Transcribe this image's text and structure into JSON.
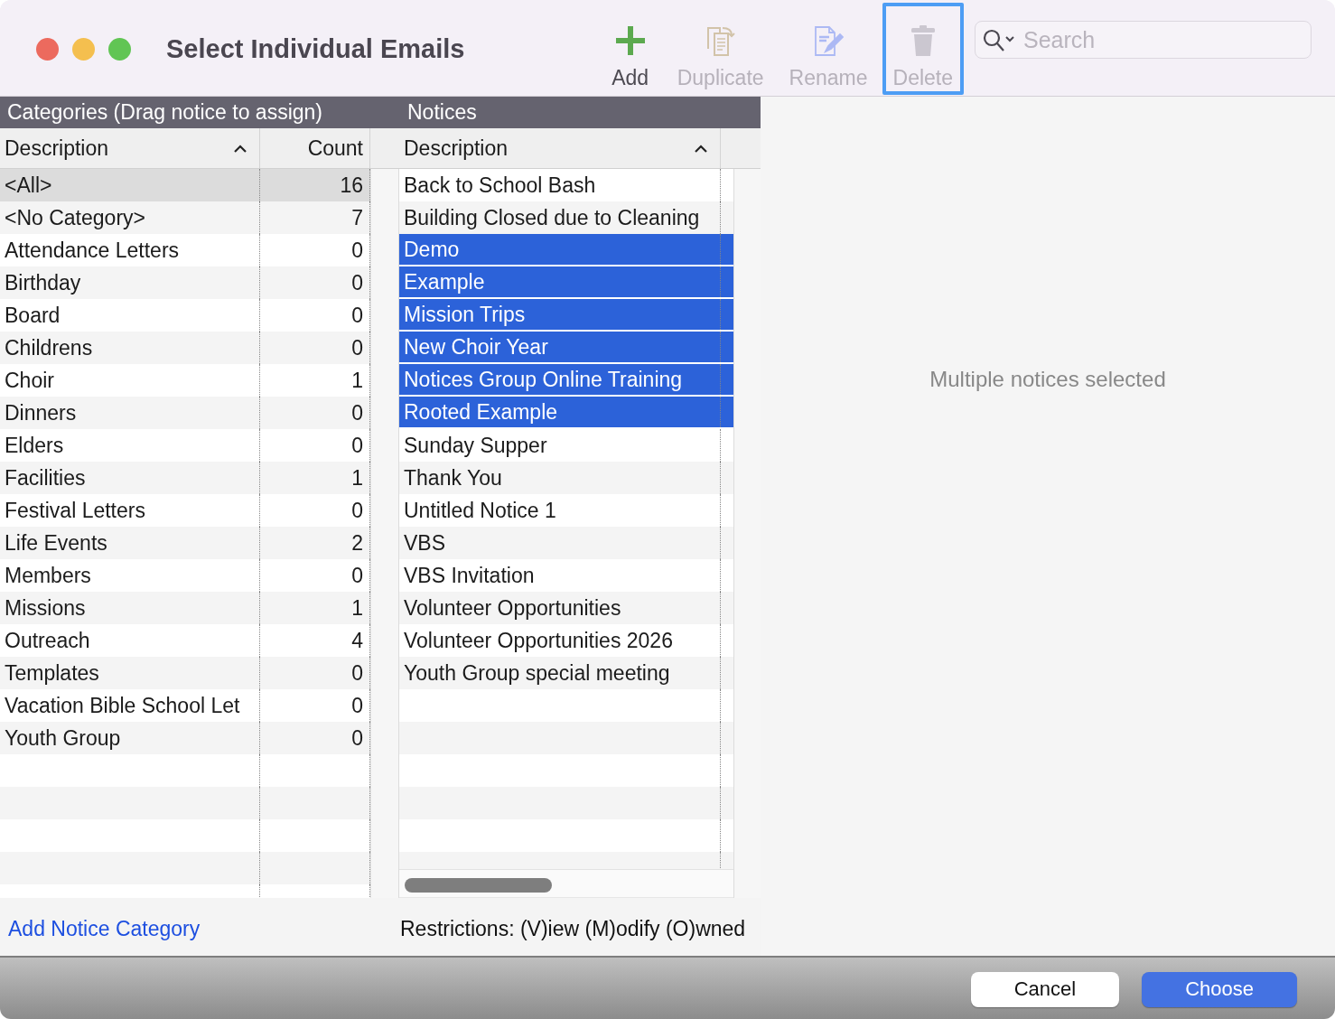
{
  "window": {
    "title": "Select Individual Emails"
  },
  "toolbar": [
    {
      "kind": "add",
      "label": "Add",
      "disabled": false,
      "focused": false
    },
    {
      "kind": "duplicate",
      "label": "Duplicate",
      "disabled": true,
      "focused": false
    },
    {
      "kind": "rename",
      "label": "Rename",
      "disabled": true,
      "focused": false
    },
    {
      "kind": "delete",
      "label": "Delete",
      "disabled": true,
      "focused": true
    }
  ],
  "search": {
    "placeholder": "Search"
  },
  "categories": {
    "title": "Categories (Drag notice to assign)",
    "columns": [
      {
        "label": "Description",
        "sorted": true
      },
      {
        "label": "Count",
        "sorted": false
      }
    ],
    "rows": [
      {
        "description": "<All>",
        "count": "16",
        "selected": true
      },
      {
        "description": "<No Category>",
        "count": "7",
        "selected": false
      },
      {
        "description": "Attendance Letters",
        "count": "0",
        "selected": false
      },
      {
        "description": "Birthday",
        "count": "0",
        "selected": false
      },
      {
        "description": "Board",
        "count": "0",
        "selected": false
      },
      {
        "description": "Childrens",
        "count": "0",
        "selected": false
      },
      {
        "description": "Choir",
        "count": "1",
        "selected": false
      },
      {
        "description": "Dinners",
        "count": "0",
        "selected": false
      },
      {
        "description": "Elders",
        "count": "0",
        "selected": false
      },
      {
        "description": "Facilities",
        "count": "1",
        "selected": false
      },
      {
        "description": "Festival Letters",
        "count": "0",
        "selected": false
      },
      {
        "description": "Life Events",
        "count": "2",
        "selected": false
      },
      {
        "description": "Members",
        "count": "0",
        "selected": false
      },
      {
        "description": "Missions",
        "count": "1",
        "selected": false
      },
      {
        "description": "Outreach",
        "count": "4",
        "selected": false
      },
      {
        "description": "Templates",
        "count": "0",
        "selected": false
      },
      {
        "description": "Vacation Bible School Let",
        "count": "0",
        "selected": false
      },
      {
        "description": "Youth Group",
        "count": "0",
        "selected": false
      }
    ]
  },
  "notices": {
    "title": "Notices",
    "columns": [
      {
        "label": "Description",
        "sorted": true
      }
    ],
    "rows": [
      {
        "description": "Back to School Bash",
        "selected": false
      },
      {
        "description": "Building Closed due to Cleaning",
        "selected": false
      },
      {
        "description": "Demo",
        "selected": true
      },
      {
        "description": "Example",
        "selected": true
      },
      {
        "description": "Mission Trips",
        "selected": true
      },
      {
        "description": "New Choir Year",
        "selected": true
      },
      {
        "description": "Notices Group Online Training",
        "selected": true
      },
      {
        "description": "Rooted Example",
        "selected": true
      },
      {
        "description": "Sunday Supper",
        "selected": false
      },
      {
        "description": "Thank You",
        "selected": false
      },
      {
        "description": "Untitled Notice 1",
        "selected": false
      },
      {
        "description": "VBS",
        "selected": false
      },
      {
        "description": "VBS Invitation",
        "selected": false
      },
      {
        "description": "Volunteer Opportunities",
        "selected": false
      },
      {
        "description": "Volunteer Opportunities 2026",
        "selected": false
      },
      {
        "description": "Youth Group special meeting",
        "selected": false
      }
    ]
  },
  "detail": {
    "message": "Multiple notices selected"
  },
  "add_category_link": "Add Notice Category",
  "restrictions_note": "Restrictions: (V)iew (M)odify (O)wned",
  "buttons": [
    {
      "label": "Cancel",
      "default": false
    },
    {
      "label": "Choose",
      "default": true
    }
  ]
}
